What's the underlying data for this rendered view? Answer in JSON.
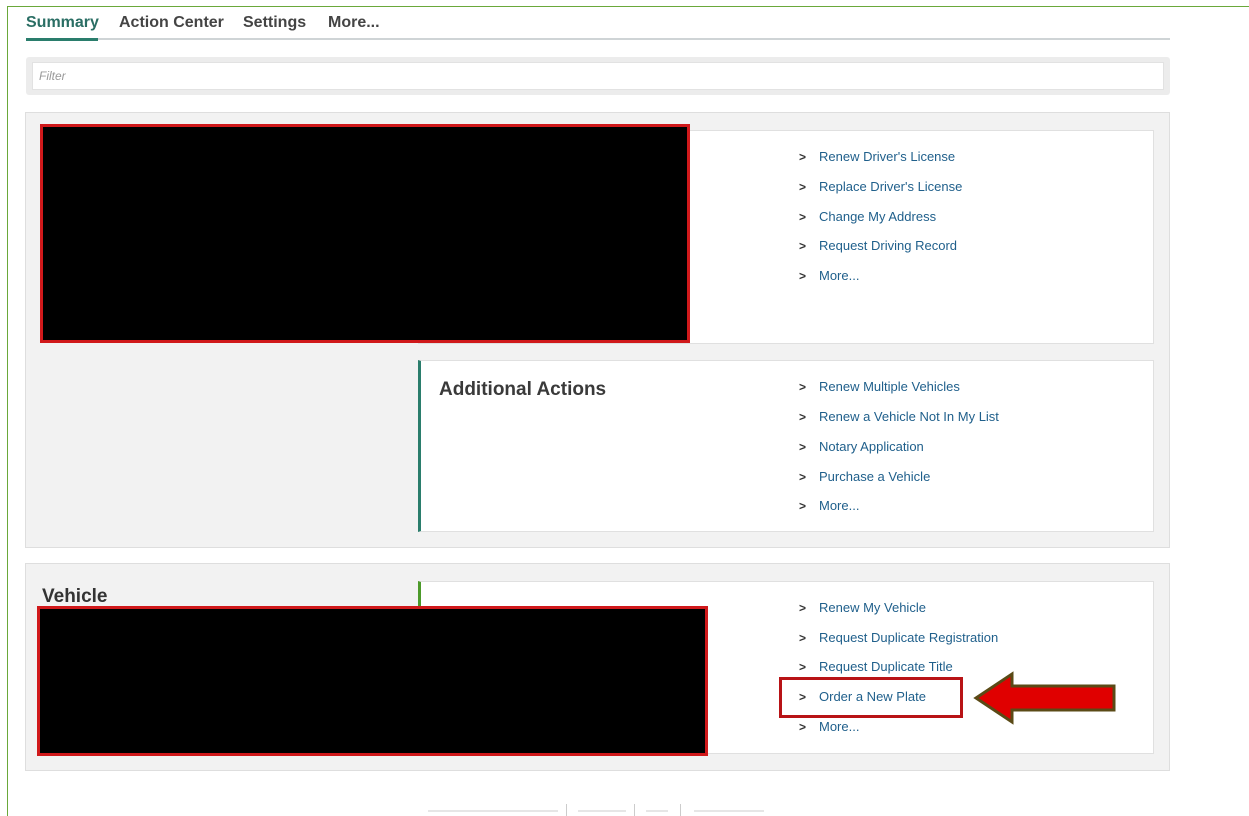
{
  "tabs": [
    {
      "label": "Summary",
      "active": true
    },
    {
      "label": "Action Center",
      "active": false
    },
    {
      "label": "Settings",
      "active": false
    },
    {
      "label": "More...",
      "active": false
    }
  ],
  "filter": {
    "placeholder": "Filter",
    "value": ""
  },
  "license_section": {
    "actions": [
      "Renew Driver's License",
      "Replace Driver's License",
      "Change My Address",
      "Request Driving Record",
      "More..."
    ]
  },
  "additional_actions": {
    "title": "Additional Actions",
    "actions": [
      "Renew Multiple Vehicles",
      "Renew a Vehicle Not In My List",
      "Notary Application",
      "Purchase a Vehicle",
      "More..."
    ]
  },
  "vehicle_section": {
    "title": "Vehicle",
    "actions": [
      "Renew My Vehicle",
      "Request Duplicate Registration",
      "Request Duplicate Title",
      "Order a New Plate",
      "More..."
    ]
  },
  "colors": {
    "accent": "#2a7d6c",
    "link": "#1f5f8b",
    "highlight": "#d0191b"
  }
}
